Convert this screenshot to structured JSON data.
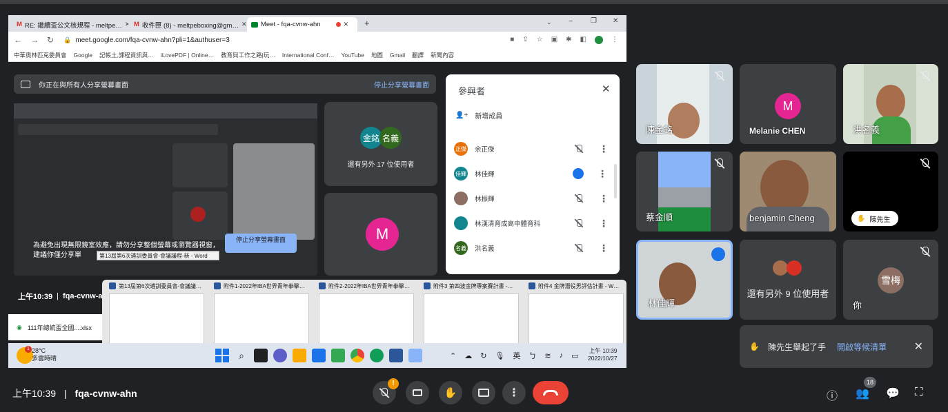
{
  "browser": {
    "tabs": [
      {
        "label": "RE: 繼續盃公文核規程 - meltpe…",
        "icon": "gmail-icon"
      },
      {
        "label": "收件匣 (8) - meltpeboxing@gm…",
        "icon": "gmail-icon"
      },
      {
        "label": "Meet - fqa-cvnw-ahn",
        "icon": "meet-icon"
      }
    ],
    "address": "meet.google.com/fqa-cvnw-ahn?pli=1&authuser=3",
    "bookmarks": [
      "中華奧林匹克委員會",
      "Google",
      "記帳土,課程資訊與…",
      "iLovePDF | Online…",
      "教育與工作之路|玩…",
      "International Conf…",
      "YouTube",
      "地圖",
      "Gmail",
      "翻譯",
      "新聞內容"
    ]
  },
  "inner": {
    "share_notice": "你正在與所有人分享螢幕畫面",
    "stop_share": "停止分享螢幕畫面",
    "tile_avatars": [
      "金銘",
      "名義"
    ],
    "others_count_text": "還有另外 17 位使用者",
    "m_avatar": "M",
    "warning_text": "為避免出現無限鏡室效應，請勿分享整個螢幕或瀏覽器視窗，建議你僅分享單",
    "stop_share_popup": "停止分享螢幕畫面",
    "word_tooltip": "第13屆第6次遴訓委員會-會議議程-新 - Word",
    "time": "上午10:39",
    "meeting_code": "fqa-cvnw-ahn",
    "download_file": "111年總統盃全國....xlsx",
    "participants": {
      "title": "參與者",
      "add": "新增成員",
      "rows": [
        {
          "avatar": "正傑",
          "name": "余正傑",
          "color": "#e8710a",
          "speaking": false
        },
        {
          "avatar": "佳輝",
          "name": "林佳輝",
          "color": "#12858f",
          "speaking": true
        },
        {
          "avatar": "",
          "name": "林振輝",
          "color": "#8d6e63",
          "speaking": false
        },
        {
          "avatar": "",
          "name": "林漢清育成高中體育科",
          "color": "#12858f",
          "speaking": false
        },
        {
          "avatar": "名義",
          "name": "洪名義",
          "color": "#33691e",
          "speaking": false
        }
      ]
    },
    "word_windows": [
      "第13屆第6次遴訓委員會-會議議…",
      "附件1-2022年IBA世界青年拳擊…",
      "附件2-2022年IBA世界青年拳擊…",
      "附件3 第四波金牌專案賽計畫 -…",
      "附件4 金牌潛役男評估計畫 - W…"
    ],
    "weather": {
      "temp": "28°C",
      "desc": "多雲時晴",
      "badge": "1"
    },
    "tray": {
      "ime1": "英",
      "ime2": "ㄅ",
      "clock_time": "上午 10:39",
      "clock_date": "2022/10/27"
    }
  },
  "grid": [
    {
      "name": "陳金銘",
      "muted": true
    },
    {
      "name": "Melanie CHEN",
      "avatar": "M",
      "muted": false
    },
    {
      "name": "洪名義",
      "muted": true
    },
    {
      "name": "蔡金順",
      "muted": true
    },
    {
      "name": "benjamin Cheng",
      "muted": false
    },
    {
      "name": "陳先生",
      "muted": true
    },
    {
      "name": "林佳輝",
      "muted": false,
      "speaking": true
    },
    {
      "name": "還有另外 9 位使用者",
      "muted": false
    },
    {
      "name": "你",
      "avatar": "雪梅",
      "muted": true
    }
  ],
  "hand_notice": {
    "text": "陳先生舉起了手",
    "action": "開啟等候清單"
  },
  "bottom": {
    "time": "上午10:39",
    "separator": "|",
    "code": "fqa-cvnw-ahn",
    "people_count": "18",
    "mic_badge": "!"
  },
  "colors": {
    "end_call": "#ea4335",
    "accent": "#8ab4f8",
    "melanie": "#e52592",
    "xuemei": "#8d6e63"
  }
}
